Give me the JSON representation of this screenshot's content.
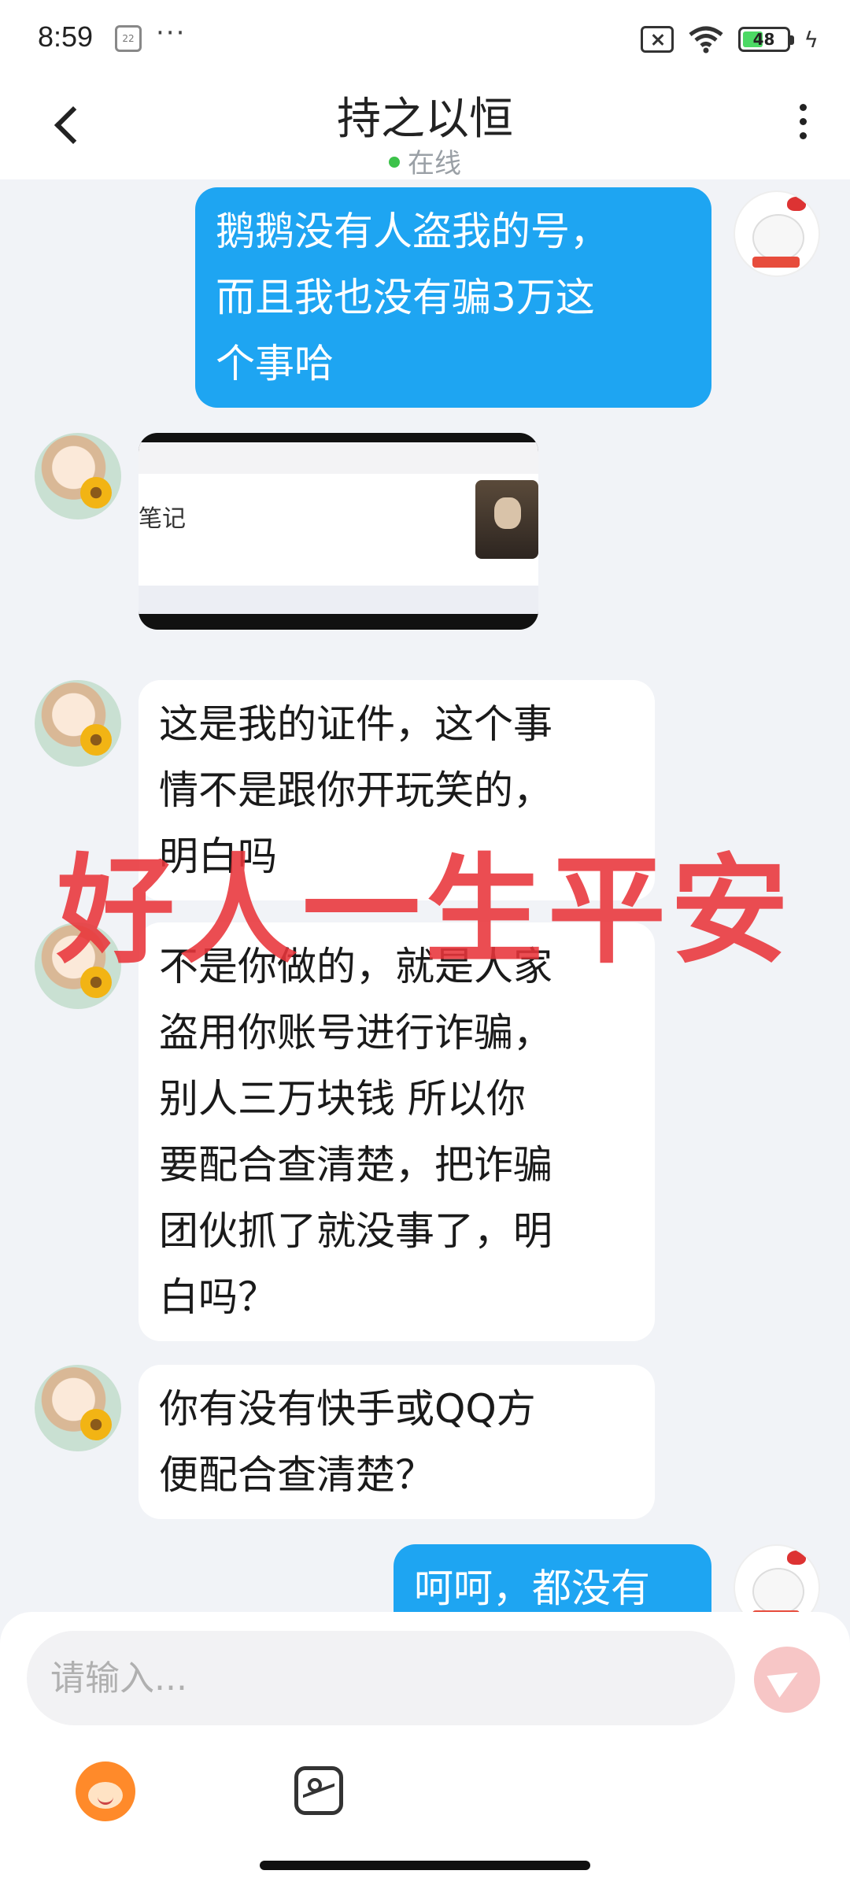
{
  "status_bar": {
    "time": "8:59",
    "calendar_day": "22",
    "more_dots": "···",
    "battery_percent": "48",
    "battery_level": 0.48
  },
  "header": {
    "title": "持之以恒",
    "online_status": "在线"
  },
  "messages": [
    {
      "sender": "me",
      "lines": [
        "鹅鹅没有人盗我的号，",
        "而且我也没有骗3万这",
        "个事哈"
      ]
    },
    {
      "sender": "them",
      "type": "image",
      "image_label": "笔记"
    },
    {
      "sender": "them",
      "lines": [
        "这是我的证件，这个事",
        "情不是跟你开玩笑的，",
        "明白吗"
      ]
    },
    {
      "sender": "them",
      "lines": [
        "不是你做的，就是人家",
        "盗用你账号进行诈骗，",
        "别人三万块钱 所以你",
        "要配合查清楚，把诈骗",
        "团伙抓了就没事了，明",
        "白吗？"
      ]
    },
    {
      "sender": "them",
      "lines": [
        "你有没有快手或QQ方",
        "便配合查清楚？"
      ]
    },
    {
      "sender": "me",
      "lines": [
        "呵呵，都没有"
      ]
    }
  ],
  "watermark": "好人一生平安",
  "input": {
    "placeholder": "请输入..."
  },
  "colors": {
    "my_bubble": "#1ea5f2",
    "their_bubble": "#ffffff",
    "watermark": "#e8343a",
    "chat_background": "#f1f3f7"
  }
}
